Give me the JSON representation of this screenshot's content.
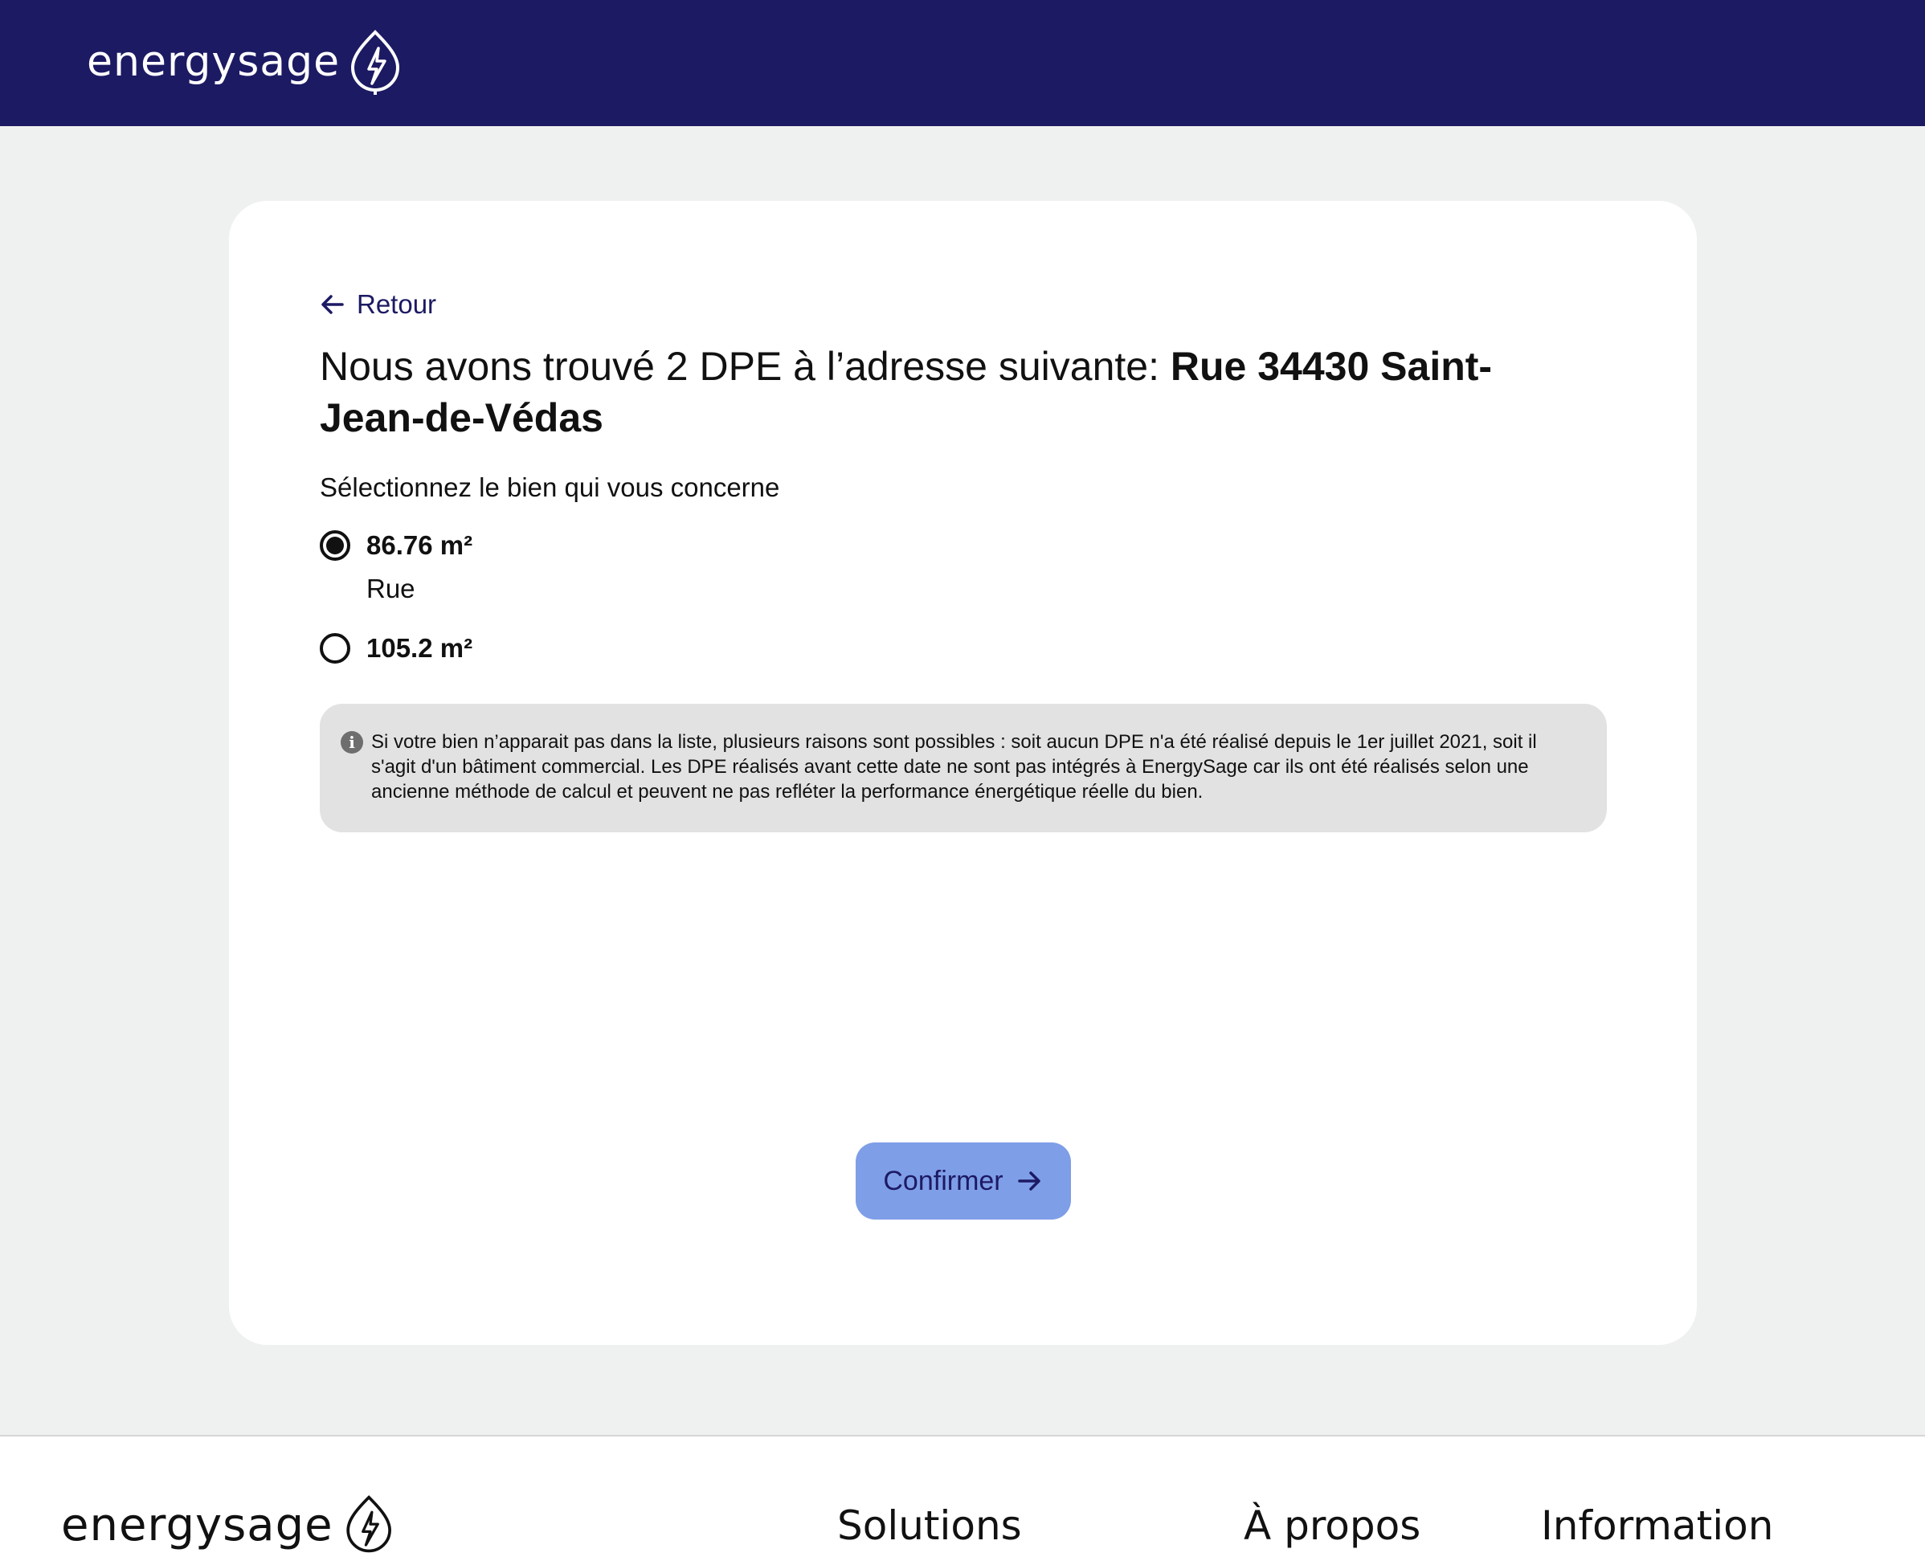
{
  "header": {
    "brand_name": "energysage",
    "logo_icon": "leaf-bolt-icon",
    "background_color": "#1c1a63"
  },
  "back_link": {
    "label": "Retour",
    "icon": "arrow-left-icon"
  },
  "main": {
    "title_prefix": "Nous avons trouvé 2 DPE à l’adresse suivante: ",
    "title_address": "Rue 34430 Saint-Jean-de-Védas",
    "subtitle": "Sélectionnez le bien qui vous concerne",
    "options": [
      {
        "area": "86.76 m²",
        "street": "Rue",
        "selected": true
      },
      {
        "area": "105.2 m²",
        "street": "",
        "selected": false
      }
    ],
    "info_icon": "info-icon",
    "info_text": "Si votre bien n’apparait pas dans la liste, plusieurs raisons sont possibles : soit aucun DPE n'a été réalisé depuis le 1er juillet 2021, soit il s'agit d'un bâtiment commercial. Les DPE réalisés avant cette date ne sont pas intégrés à EnergySage car ils ont été réalisés selon une ancienne méthode de calcul et peuvent ne pas refléter la performance énergétique réelle du bien.",
    "confirm_label": "Confirmer",
    "confirm_icon": "arrow-right-icon",
    "accent_color": "#7f9ee8"
  },
  "footer": {
    "brand_name": "energysage",
    "links": [
      "Solutions",
      "À propos",
      "Information"
    ]
  }
}
